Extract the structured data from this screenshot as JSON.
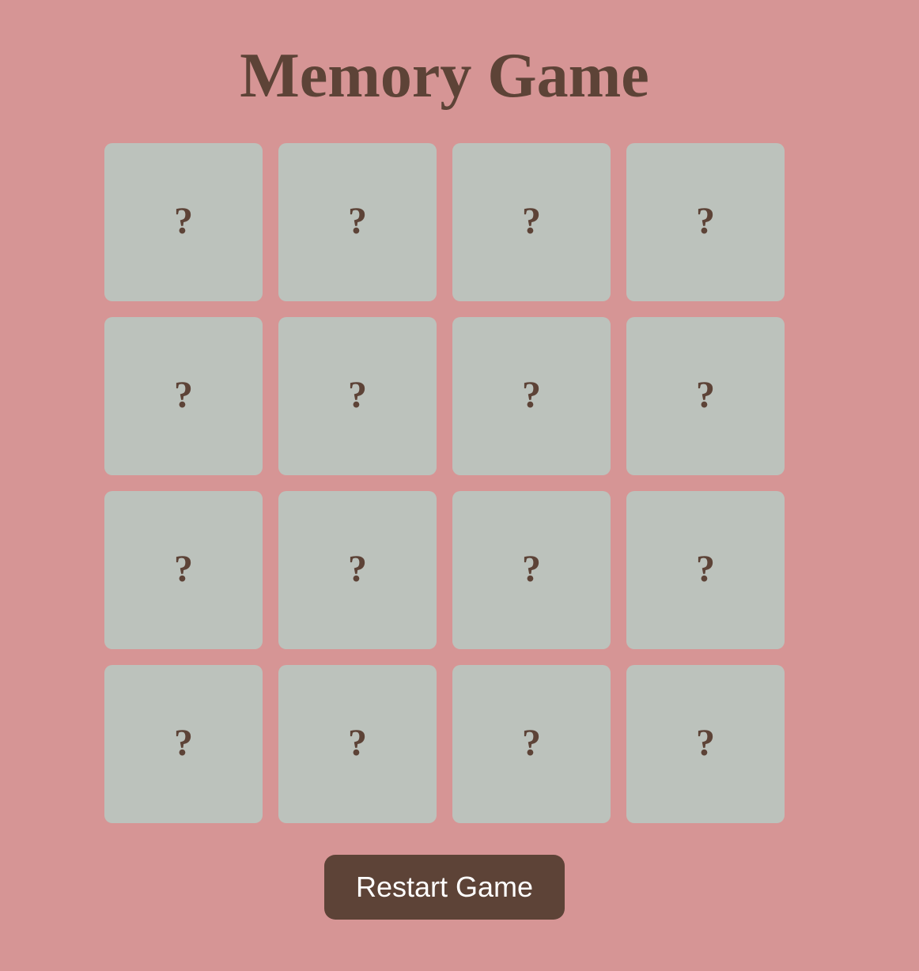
{
  "title": "Memory Game",
  "cards": [
    {
      "label": "?"
    },
    {
      "label": "?"
    },
    {
      "label": "?"
    },
    {
      "label": "?"
    },
    {
      "label": "?"
    },
    {
      "label": "?"
    },
    {
      "label": "?"
    },
    {
      "label": "?"
    },
    {
      "label": "?"
    },
    {
      "label": "?"
    },
    {
      "label": "?"
    },
    {
      "label": "?"
    },
    {
      "label": "?"
    },
    {
      "label": "?"
    },
    {
      "label": "?"
    },
    {
      "label": "?"
    }
  ],
  "restart_label": "Restart Game",
  "colors": {
    "background": "#d69595",
    "card": "#bcc2bc",
    "text": "#5d4337",
    "button": "#5d4337",
    "button_text": "#ffffff"
  }
}
